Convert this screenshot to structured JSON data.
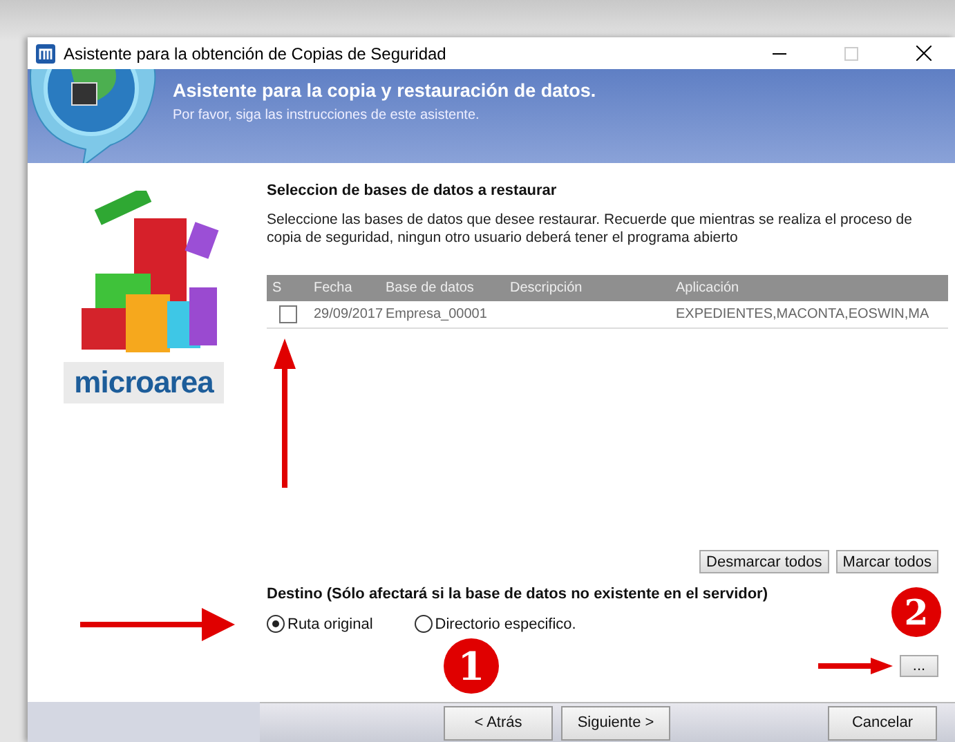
{
  "window": {
    "title": "Asistente para la obtención de Copias de Seguridad",
    "maximize_disabled": true
  },
  "banner": {
    "title": "Asistente para la copia y restauración de datos.",
    "subtitle": "Por favor, siga las instrucciones de este asistente."
  },
  "logo": {
    "text": "microarea"
  },
  "section": {
    "title": "Seleccion de bases de datos a restaurar",
    "description": "Seleccione las bases de datos que desee restaurar. Recuerde que mientras se realiza el proceso de copia de seguridad, ningun otro usuario deberá tener el programa abierto"
  },
  "table": {
    "columns": [
      "S",
      "Fecha",
      "Base de datos",
      "Descripción",
      "Aplicación"
    ],
    "rows": [
      {
        "checked": false,
        "fecha": "29/09/2017",
        "base": "Empresa_00001",
        "aplicacion": "EXPEDIENTES,MACONTA,EOSWIN,MA"
      }
    ]
  },
  "selection_buttons": [
    "Desmarcar todos",
    "Marcar todos"
  ],
  "destination": {
    "title": "Destino (Sólo afectará si la base de datos no existente en el servidor)",
    "options": [
      {
        "label": "Ruta original",
        "selected": true
      },
      {
        "label": "Directorio especifico.",
        "selected": false
      }
    ],
    "browse": "..."
  },
  "nav_buttons": [
    "< Atrás",
    "Siguiente >",
    "Cancelar"
  ],
  "markers": [
    "1",
    "2"
  ]
}
